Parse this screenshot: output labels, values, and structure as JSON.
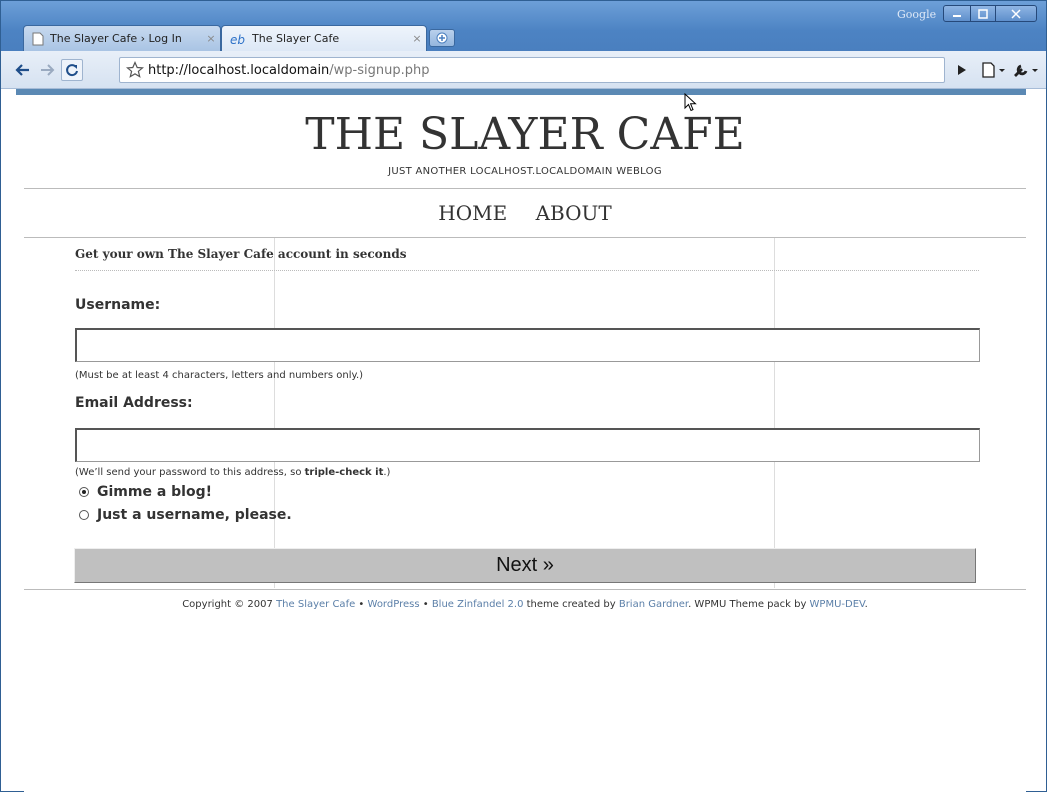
{
  "browser": {
    "tabs": [
      {
        "title": "The Slayer Cafe › Log In",
        "close": "×"
      },
      {
        "title": "The Slayer Cafe",
        "close": "×"
      }
    ],
    "google_label": "Google",
    "address": {
      "host": "http://localhost.localdomain",
      "path": "/wp-signup.php"
    },
    "icons": [
      "back-arrow-icon",
      "forward-arrow-icon",
      "reload-icon",
      "star-icon",
      "page-menu-icon",
      "wrench-icon",
      "play-icon",
      "new-tab-icon"
    ]
  },
  "site": {
    "title": "THE SLAYER CAFE",
    "tagline": "JUST ANOTHER LOCALHOST.LOCALDOMAIN WEBLOG",
    "nav": [
      "HOME",
      "ABOUT"
    ]
  },
  "signup": {
    "heading": "Get your own The Slayer Cafe account in seconds",
    "username_label": "Username:",
    "username_value": "",
    "username_hint": "(Must be at least 4 characters, letters and numbers only.)",
    "email_label": "Email Address:",
    "email_value": "",
    "email_hint_pre": "(We’ll send your password to this address, so ",
    "email_hint_bold": "triple-check it",
    "email_hint_post": ".)",
    "options": [
      {
        "label": "Gimme a blog!",
        "checked": true
      },
      {
        "label": "Just a username, please.",
        "checked": false
      }
    ],
    "next_label": "Next »"
  },
  "footer": {
    "prefix": "Copyright © 2007 ",
    "site_link": "The Slayer Cafe",
    "sep1": " • ",
    "wp_link": "WordPress",
    "sep2": " • ",
    "theme_link": "Blue Zinfandel 2.0",
    "mid": " theme created by ",
    "author_link": "Brian Gardner",
    "mid2": ". WPMU Theme pack by ",
    "pack_link": "WPMU-DEV",
    "end": "."
  },
  "colors": {
    "accent": "#5b89b4",
    "link": "#5b7fa8",
    "button": "#c0c0c0"
  }
}
